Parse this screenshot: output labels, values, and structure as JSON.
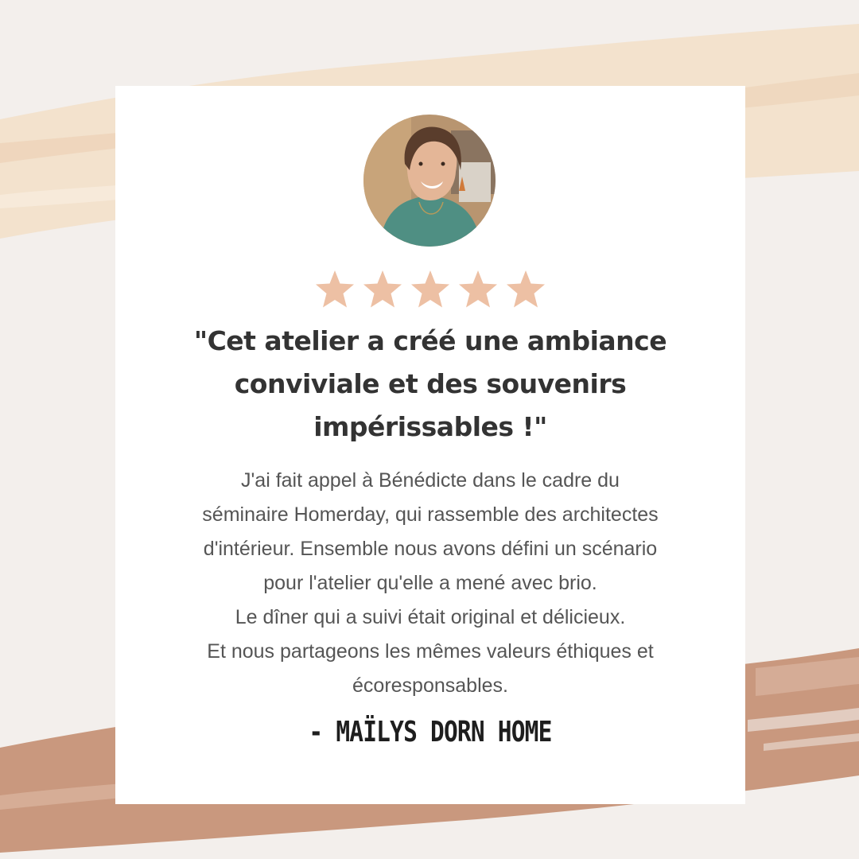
{
  "colors": {
    "background": "#f3efec",
    "brush_light": "#f2dfc8",
    "brush_dark": "#c9987e",
    "card": "#ffffff",
    "star": "#edc0a4",
    "quote_text": "#333333",
    "body_text": "#555555",
    "signature_text": "#1e1e1e"
  },
  "testimonial": {
    "avatar_icon": "portrait-photo",
    "rating": {
      "value": 5,
      "max": 5
    },
    "quote": "\"Cet atelier a créé une ambiance conviviale et des souvenirs impérissables !\"",
    "body_lines": [
      "J'ai fait appel à Bénédicte dans le cadre du",
      "séminaire Homerday, qui rassemble des architectes",
      "d'intérieur. Ensemble nous avons défini un scénario",
      "pour l'atelier qu'elle a mené avec brio.",
      "Le dîner qui a suivi était original et délicieux.",
      "Et nous partageons les mêmes valeurs éthiques et",
      "écoresponsables."
    ],
    "signature": "- MAÏLYS DORN HOME"
  }
}
